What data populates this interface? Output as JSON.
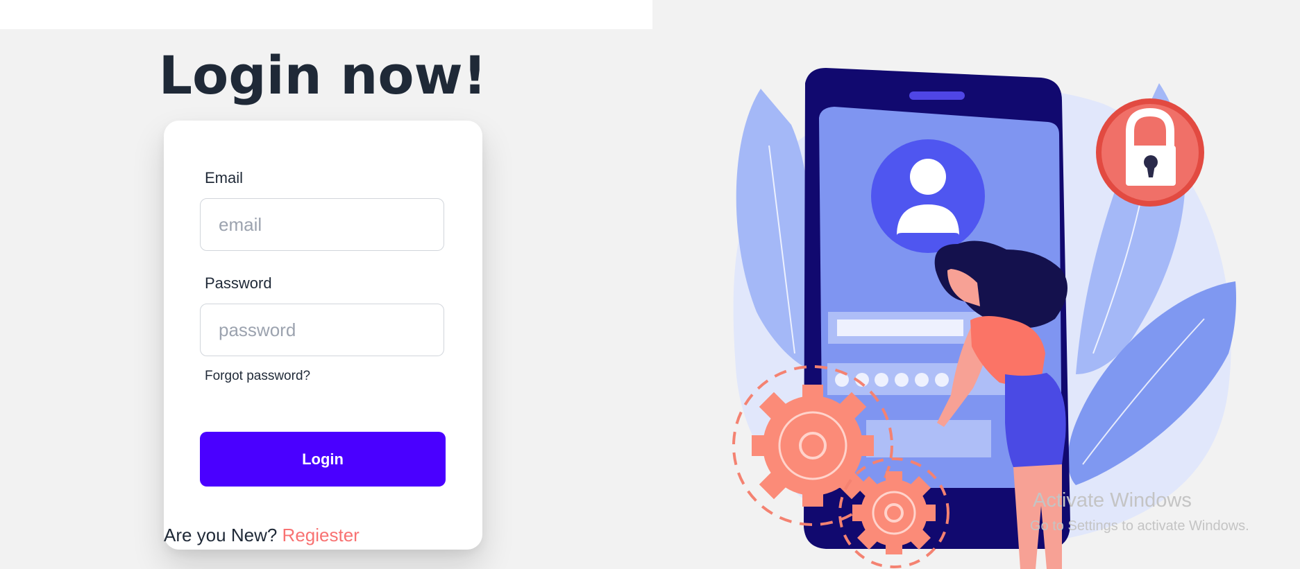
{
  "page": {
    "title": "Login now!"
  },
  "form": {
    "email_label": "Email",
    "email_placeholder": "email",
    "email_value": "",
    "password_label": "Password",
    "password_placeholder": "password",
    "password_value": "",
    "forgot_label": "Forgot password?",
    "login_label": "Login",
    "register_prompt": "Are you New?",
    "register_link": "Regiester"
  },
  "illustration": {
    "icons": [
      "user-avatar-icon",
      "padlock-icon",
      "gear-icon"
    ],
    "password_dots": 6
  },
  "watermark": {
    "title": "Activate Windows",
    "subtitle": "Go to Settings to activate Windows."
  },
  "colors": {
    "primary": "#4a00ff",
    "secondary": "#f87272",
    "heading": "#1f2937",
    "background": "#f2f2f2"
  }
}
